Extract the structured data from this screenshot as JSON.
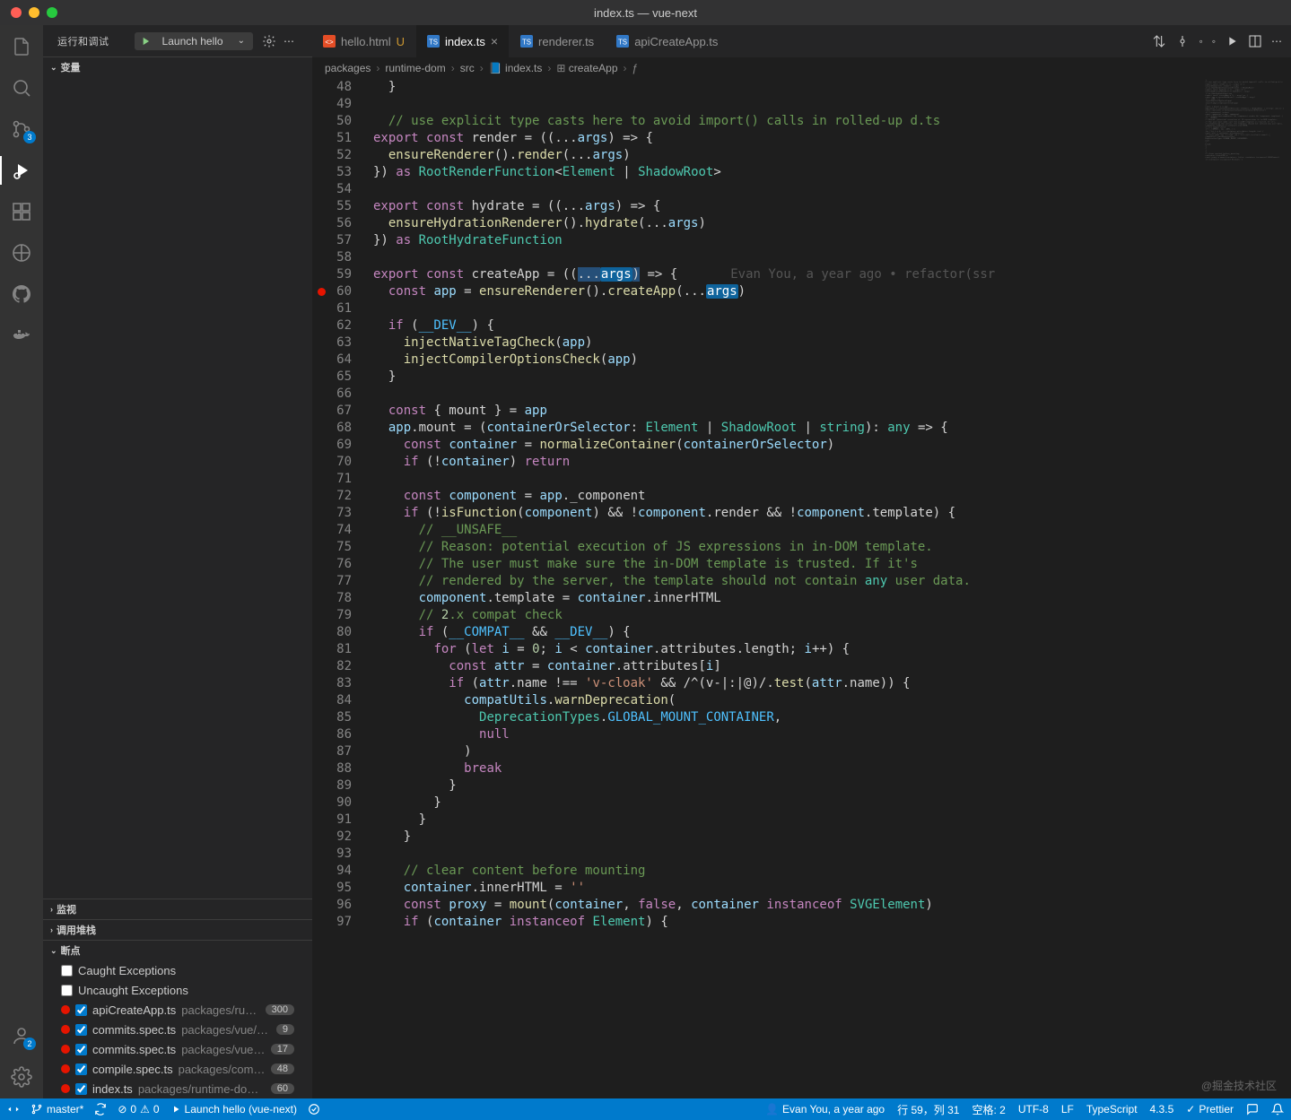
{
  "window": {
    "title": "index.ts — vue-next"
  },
  "sidebar": {
    "title": "运行和调试",
    "launch_config": "Launch hello",
    "sections": {
      "variables": "变量",
      "watch": "监视",
      "callstack": "调用堆栈",
      "breakpoints": "断点"
    },
    "exceptions": {
      "caught": "Caught Exceptions",
      "uncaught": "Uncaught Exceptions"
    },
    "bps": [
      {
        "file": "apiCreateApp.ts",
        "path": "packages/runtime-core/src",
        "count": "300"
      },
      {
        "file": "commits.spec.ts",
        "path": "packages/vue/examples/__tests__",
        "count": "9"
      },
      {
        "file": "commits.spec.ts",
        "path": "packages/vue/examples/__tests__",
        "count": "17"
      },
      {
        "file": "compile.spec.ts",
        "path": "packages/compiler-core/__tests__",
        "count": "48"
      },
      {
        "file": "index.ts",
        "path": "packages/runtime-dom/src",
        "count": "60"
      }
    ]
  },
  "activity": {
    "scm_badge": "3",
    "acct_badge": "2"
  },
  "tabs": [
    {
      "label": "hello.html",
      "mod": "U",
      "icon": "html"
    },
    {
      "label": "index.ts",
      "active": true,
      "icon": "ts"
    },
    {
      "label": "renderer.ts",
      "icon": "ts"
    },
    {
      "label": "apiCreateApp.ts",
      "icon": "ts"
    }
  ],
  "breadcrumb": [
    "packages",
    "runtime-dom",
    "src",
    "index.ts",
    "createApp",
    "<function>"
  ],
  "code": {
    "first_line": 48,
    "breakpoint_line": 60,
    "lines": [
      "  }",
      "",
      "  // use explicit type casts here to avoid import() calls in rolled-up d.ts",
      "export const render = ((...args) => {",
      "  ensureRenderer().render(...args)",
      "}) as RootRenderFunction<Element | ShadowRoot>",
      "",
      "export const hydrate = ((...args) => {",
      "  ensureHydrationRenderer().hydrate(...args)",
      "}) as RootHydrateFunction",
      "",
      "export const createApp = ((...args) => {",
      "  const app = ensureRenderer().createApp(...args)",
      "",
      "  if (__DEV__) {",
      "    injectNativeTagCheck(app)",
      "    injectCompilerOptionsCheck(app)",
      "  }",
      "",
      "  const { mount } = app",
      "  app.mount = (containerOrSelector: Element | ShadowRoot | string): any => {",
      "    const container = normalizeContainer(containerOrSelector)",
      "    if (!container) return",
      "",
      "    const component = app._component",
      "    if (!isFunction(component) && !component.render && !component.template) {",
      "      // __UNSAFE__",
      "      // Reason: potential execution of JS expressions in in-DOM template.",
      "      // The user must make sure the in-DOM template is trusted. If it's",
      "      // rendered by the server, the template should not contain any user data.",
      "      component.template = container.innerHTML",
      "      // 2.x compat check",
      "      if (__COMPAT__ && __DEV__) {",
      "        for (let i = 0; i < container.attributes.length; i++) {",
      "          const attr = container.attributes[i]",
      "          if (attr.name !== 'v-cloak' && /^(v-|:|@)/.test(attr.name)) {",
      "            compatUtils.warnDeprecation(",
      "              DeprecationTypes.GLOBAL_MOUNT_CONTAINER,",
      "              null",
      "            )",
      "            break",
      "          }",
      "        }",
      "      }",
      "    }",
      "",
      "    // clear content before mounting",
      "    container.innerHTML = ''",
      "    const proxy = mount(container, false, container instanceof SVGElement)",
      "    if (container instanceof Element) {"
    ],
    "blame": "Evan You, a year ago • refactor(ssr"
  },
  "statusbar": {
    "branch": "master*",
    "errors": "0",
    "warnings": "0",
    "launch": "Launch hello (vue-next)",
    "blame": "Evan You, a year ago",
    "ln_col": "行 59，列 31",
    "spaces": "空格: 2",
    "encoding": "UTF-8",
    "eol": "LF",
    "lang": "TypeScript",
    "ver": "4.3.5",
    "prettier": "Prettier"
  },
  "watermark": "@掘金技术社区"
}
